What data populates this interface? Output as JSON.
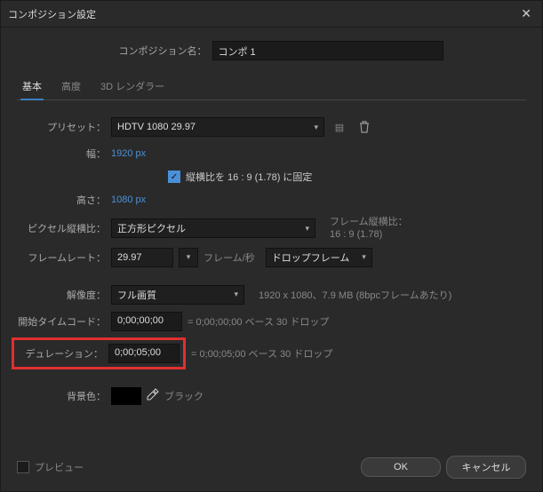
{
  "title": "コンポジション設定",
  "comp_name_label": "コンポジション名：",
  "comp_name_value": "コンポ 1",
  "tabs": {
    "basic": "基本",
    "advanced": "高度",
    "renderer": "3D レンダラー"
  },
  "preset": {
    "label": "プリセット：",
    "value": "HDTV 1080 29.97"
  },
  "width": {
    "label": "幅：",
    "value": "1920 px"
  },
  "height": {
    "label": "高さ：",
    "value": "1080 px"
  },
  "lock_aspect": "縦横比を 16 : 9 (1.78) に固定",
  "pixel_aspect": {
    "label": "ピクセル縦横比：",
    "value": "正方形ピクセル",
    "info_label": "フレーム縦横比：",
    "info_value": "16 : 9 (1.78)"
  },
  "framerate": {
    "label": "フレームレート：",
    "value": "29.97",
    "per": "フレーム/秒",
    "dropdown": "ドロップフレーム"
  },
  "resolution": {
    "label": "解像度：",
    "value": "フル画質",
    "info": "1920 x 1080、7.9 MB (8bpcフレームあたり)"
  },
  "start_tc": {
    "label": "開始タイムコード：",
    "value": "0;00;00;00",
    "info": "= 0;00;00;00  ベース 30  ドロップ"
  },
  "duration": {
    "label": "デュレーション：",
    "value": "0;00;05;00",
    "info": "= 0;00;05;00  ベース 30  ドロップ"
  },
  "bgcolor": {
    "label": "背景色：",
    "name": "ブラック"
  },
  "preview": "プレビュー",
  "ok": "OK",
  "cancel": "キャンセル"
}
